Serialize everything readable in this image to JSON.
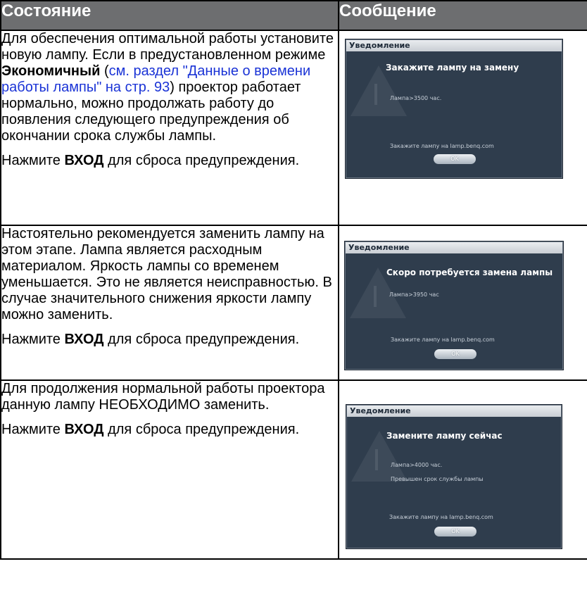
{
  "header": {
    "col_state": "Состояние",
    "col_message": "Сообщение"
  },
  "rows": [
    {
      "p1_a": "Для обеспечения оптимальной работы установите новую лампу. Если в предустановленном режиме ",
      "p1_bold": "Экономичный",
      "p1_b": " (",
      "p1_link": "см. раздел  \"Данные о времени работы лампы\" на стр. 93",
      "p1_c": ") проектор работает нормально, можно продолжать работу до появления следующего предупреждения об окончании срока службы лампы.",
      "p2_a": "Нажмите ",
      "p2_bold": "ВХОД",
      "p2_b": " для сброса предупреждения.",
      "dialog": {
        "bar_title": "Уведомление",
        "title": "Закажите лампу на замену",
        "hours": "Лампа>3500 час.",
        "order": "Закажите лампу на lamp.benq.com",
        "ok": "OK"
      }
    },
    {
      "p1": "Настоятельно рекомендуется заменить лампу на этом этапе. Лампа является расходным материалом. Яркость лампы со временем уменьшается. Это не является неисправностью. В случае значительного снижения яркости лампу можно заменить.",
      "p2_a": "Нажмите ",
      "p2_bold": "ВХОД",
      "p2_b": " для сброса предупреждения.",
      "dialog": {
        "bar_title": "Уведомление",
        "title": "Скоро потребуется замена лампы",
        "hours": "Лампа>3950 час",
        "order": "Закажите лампу на lamp.benq.com",
        "ok": "OK"
      }
    },
    {
      "p1": "Для продолжения нормальной работы проектора данную лампу НЕОБХОДИМО заменить.",
      "p2_a": "Нажмите ",
      "p2_bold": "ВХОД",
      "p2_b": " для сброса предупреждения.",
      "dialog": {
        "bar_title": "Уведомление",
        "title": "Замените лампу сейчас",
        "hours": "Лампа>4000 час.",
        "expired": "Превышен срок службы лампы",
        "order": "Закажите лампу на lamp.benq.com",
        "ok": "OK"
      }
    }
  ]
}
